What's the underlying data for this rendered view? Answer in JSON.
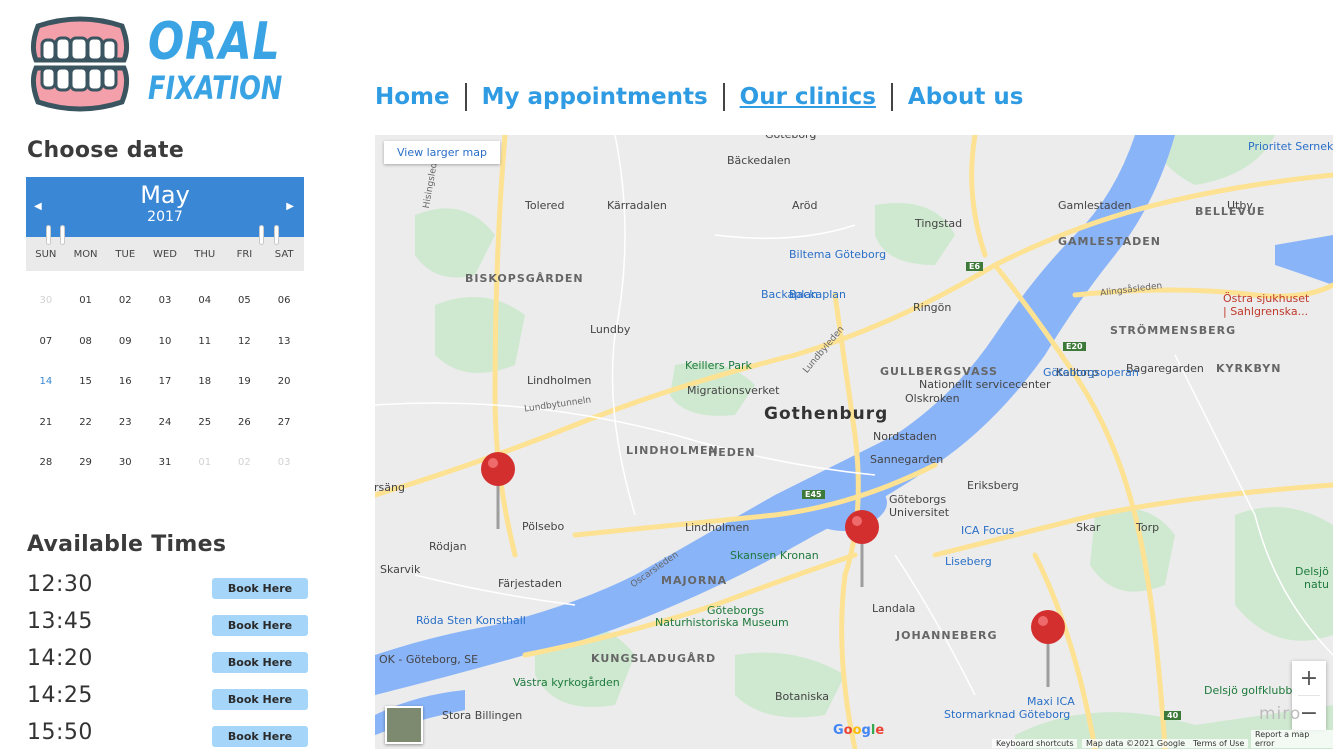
{
  "brand": {
    "line1": "ORAL",
    "line2": "FIXATION",
    "color": "#3aa3e3"
  },
  "nav": {
    "items": [
      {
        "label": "Home",
        "active": false
      },
      {
        "label": "My appointments",
        "active": false
      },
      {
        "label": "Our clinics",
        "active": true
      },
      {
        "label": "About us",
        "active": false
      }
    ]
  },
  "date_section": {
    "title": "Choose date"
  },
  "calendar": {
    "month": "May",
    "year": "2017",
    "weekdays": [
      "SUN",
      "MON",
      "TUE",
      "WED",
      "THU",
      "FRI",
      "SAT"
    ],
    "weeks": [
      [
        "30",
        "01",
        "02",
        "03",
        "04",
        "05",
        "06"
      ],
      [
        "07",
        "08",
        "09",
        "10",
        "11",
        "12",
        "13"
      ],
      [
        "14",
        "15",
        "16",
        "17",
        "18",
        "19",
        "20"
      ],
      [
        "21",
        "22",
        "23",
        "24",
        "25",
        "26",
        "27"
      ],
      [
        "28",
        "29",
        "30",
        "31",
        "01",
        "02",
        "03"
      ]
    ],
    "today": "14",
    "accent": "#3a87d5"
  },
  "times_section": {
    "title": "Available Times",
    "button_label": "Book Here",
    "slots": [
      "12:30",
      "13:45",
      "14:20",
      "14:25",
      "15:50"
    ]
  },
  "map": {
    "view_larger": "View larger map",
    "google": "Google",
    "watermark": "miro",
    "footer": {
      "shortcuts": "Keyboard shortcuts",
      "data": "Map data ©2021 Google",
      "terms": "Terms of Use",
      "report": "Report a map error"
    },
    "labels": [
      {
        "text": "Göteborg",
        "kind": "plain"
      },
      {
        "text": "Bäckedalen",
        "kind": "plain"
      },
      {
        "text": "Tolered",
        "kind": "plain"
      },
      {
        "text": "Kärradalen",
        "kind": "plain"
      },
      {
        "text": "Aröd",
        "kind": "plain"
      },
      {
        "text": "Tingstad",
        "kind": "plain"
      },
      {
        "text": "Gamlestaden",
        "kind": "plain"
      },
      {
        "text": "Utby",
        "kind": "plain"
      },
      {
        "text": "BELLEVUE",
        "kind": "dist"
      },
      {
        "text": "GAMLESTADEN",
        "kind": "dist"
      },
      {
        "text": "Prioritet Serneke",
        "kind": "poi"
      },
      {
        "text": "Biltema Göteborg",
        "kind": "poi"
      },
      {
        "text": "Backaplan",
        "kind": "poi"
      },
      {
        "text": "Backaplan",
        "kind": "poi"
      },
      {
        "text": "BISKOPSGÅRDEN",
        "kind": "dist"
      },
      {
        "text": "Lundby",
        "kind": "plain"
      },
      {
        "text": "Ringön",
        "kind": "plain"
      },
      {
        "text": "Östra sjukhuset",
        "kind": "red"
      },
      {
        "text": "| Sahlgrenska...",
        "kind": "red"
      },
      {
        "text": "STRÖMMENSBERG",
        "kind": "dist"
      },
      {
        "text": "GULLBERGSVASS",
        "kind": "dist"
      },
      {
        "text": "Bagaregarden",
        "kind": "plain"
      },
      {
        "text": "Kalltorp",
        "kind": "plain"
      },
      {
        "text": "KYRKBYN",
        "kind": "dist"
      },
      {
        "text": "Lindholmen",
        "kind": "plain"
      },
      {
        "text": "Keillers Park",
        "kind": "park"
      },
      {
        "text": "Migrationsverket",
        "kind": "plain"
      },
      {
        "text": "Nationellt servicecenter",
        "kind": "plain"
      },
      {
        "text": "Olskroken",
        "kind": "plain"
      },
      {
        "text": "Göteborgsoperan",
        "kind": "poi"
      },
      {
        "text": "Gothenburg",
        "kind": "city"
      },
      {
        "text": "Nordstaden",
        "kind": "plain"
      },
      {
        "text": "Sannegarden",
        "kind": "plain"
      },
      {
        "text": "LINDHOLMEN",
        "kind": "dist"
      },
      {
        "text": "HEDEN",
        "kind": "dist"
      },
      {
        "text": "Eriksberg",
        "kind": "plain"
      },
      {
        "text": "Göteborgs",
        "kind": "plain"
      },
      {
        "text": "Universitet",
        "kind": "plain"
      },
      {
        "text": "rsäng",
        "kind": "plain"
      },
      {
        "text": "Pölsebo",
        "kind": "plain"
      },
      {
        "text": "Lindholmen",
        "kind": "plain"
      },
      {
        "text": "ICA Focus",
        "kind": "poi"
      },
      {
        "text": "Skar",
        "kind": "plain"
      },
      {
        "text": "Torp",
        "kind": "plain"
      },
      {
        "text": "Rödjan",
        "kind": "plain"
      },
      {
        "text": "Skansen Kronan",
        "kind": "park"
      },
      {
        "text": "Liseberg",
        "kind": "poi"
      },
      {
        "text": "Skarvik",
        "kind": "plain"
      },
      {
        "text": "Färjestaden",
        "kind": "plain"
      },
      {
        "text": "MAJORNA",
        "kind": "dist"
      },
      {
        "text": "Delsjö",
        "kind": "park"
      },
      {
        "text": "natu",
        "kind": "park"
      },
      {
        "text": "Göteborgs",
        "kind": "park"
      },
      {
        "text": "Röda Sten Konsthall",
        "kind": "poi"
      },
      {
        "text": "Naturhistoriska Museum",
        "kind": "park"
      },
      {
        "text": "Landala",
        "kind": "plain"
      },
      {
        "text": "JOHANNEBERG",
        "kind": "dist"
      },
      {
        "text": "OK - Göteborg, SE",
        "kind": "plain"
      },
      {
        "text": "KUNGSLADUGÅRD",
        "kind": "dist"
      },
      {
        "text": "Västra kyrkogården",
        "kind": "park"
      },
      {
        "text": "Botaniska",
        "kind": "plain"
      },
      {
        "text": "Maxi ICA",
        "kind": "poi"
      },
      {
        "text": "Stormarknad Göteborg",
        "kind": "poi"
      },
      {
        "text": "Delsjö golfklubb",
        "kind": "park"
      },
      {
        "text": "Stora Billingen",
        "kind": "plain"
      },
      {
        "text": "Lundbytunneln",
        "kind": "road"
      },
      {
        "text": "Lundbyleden",
        "kind": "road"
      },
      {
        "text": "Oscarsleden",
        "kind": "road"
      },
      {
        "text": "Alingsåsleden",
        "kind": "road"
      },
      {
        "text": "Hisingsleden",
        "kind": "road"
      },
      {
        "text": "E6",
        "kind": "shield"
      },
      {
        "text": "E45",
        "kind": "shield"
      },
      {
        "text": "E20",
        "kind": "shield"
      },
      {
        "text": "40",
        "kind": "shield"
      }
    ],
    "colors": {
      "land": "#ececec",
      "water": "#8ab4f8",
      "park": "#c8e6c9",
      "road": "#fde293",
      "pin": "#d32f2f"
    }
  }
}
